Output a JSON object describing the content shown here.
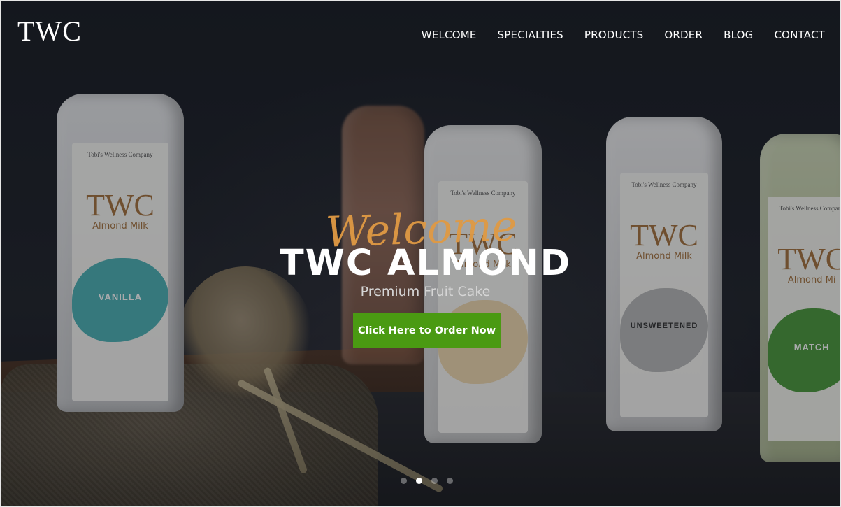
{
  "brand": {
    "logo_text": "TWC"
  },
  "nav": {
    "items": [
      {
        "label": "WELCOME"
      },
      {
        "label": "SPECIALTIES"
      },
      {
        "label": "PRODUCTS"
      },
      {
        "label": "ORDER"
      },
      {
        "label": "BLOG"
      },
      {
        "label": "CONTACT"
      }
    ]
  },
  "hero": {
    "script_text": "Welcome",
    "title": "TWC ALMOND",
    "subtitle": "Premium Fruit Cake",
    "cta_label": "Click Here to Order Now"
  },
  "bottles": [
    {
      "company": "Tobi's Wellness Company",
      "brand": "TWC",
      "product": "Almond Milk",
      "flavor": "VANILLA"
    },
    {
      "company": "Tobi's Wellness Company",
      "brand": "TWC",
      "product": "Almond Milk",
      "flavor": "UNSWEETENED"
    },
    {
      "company": "Tobi's Wellness Company",
      "brand": "TWC",
      "product": "Almond Mi",
      "flavor": "MATCH"
    }
  ],
  "carousel": {
    "slide_count": 4,
    "active_index": 1
  },
  "colors": {
    "accent_orange": "#e09a44",
    "cta_green": "#4a9a12",
    "background": "#1c1e24"
  }
}
